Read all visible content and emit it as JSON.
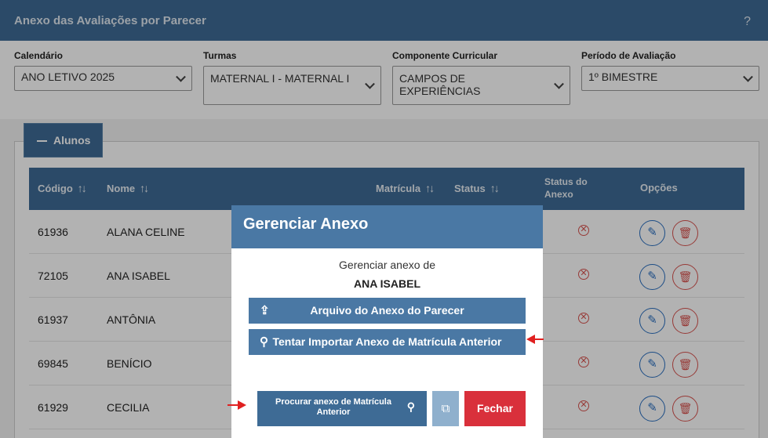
{
  "header": {
    "title": "Anexo das Avaliações por Parecer",
    "help": "?"
  },
  "filters": [
    {
      "label": "Calendário",
      "value": "ANO LETIVO 2025"
    },
    {
      "label": "Turmas",
      "value": "MATERNAL I - MATERNAL I"
    },
    {
      "label": "Componente Curricular",
      "value": "CAMPOS DE EXPERIÊNCIAS"
    },
    {
      "label": "Período de Avaliação",
      "value": "1º BIMESTRE"
    }
  ],
  "tab": {
    "label": "Alunos"
  },
  "table": {
    "headers": {
      "codigo": "Código",
      "nome": "Nome",
      "matricula": "Matrícula",
      "status": "Status",
      "status_anexo": "Status do Anexo",
      "opcoes": "Opções"
    },
    "rows": [
      {
        "codigo": "61936",
        "nome": "ALANA CELINE"
      },
      {
        "codigo": "72105",
        "nome": "ANA ISABEL"
      },
      {
        "codigo": "61937",
        "nome": "ANTÔNIA"
      },
      {
        "codigo": "69845",
        "nome": "BENÍCIO"
      },
      {
        "codigo": "61929",
        "nome": "CECILIA"
      }
    ]
  },
  "modal": {
    "title": "Gerenciar Anexo",
    "subtitle": "Gerenciar anexo de",
    "student": "ANA ISABEL",
    "btn_arquivo": "Arquivo do Anexo do Parecer",
    "btn_importar": "Tentar Importar Anexo de Matrícula Anterior",
    "btn_procurar": "Procurar anexo de Matrícula Anterior",
    "btn_fechar": "Fechar"
  },
  "colors": {
    "primary": "#3e6b95",
    "danger": "#d9303b"
  }
}
